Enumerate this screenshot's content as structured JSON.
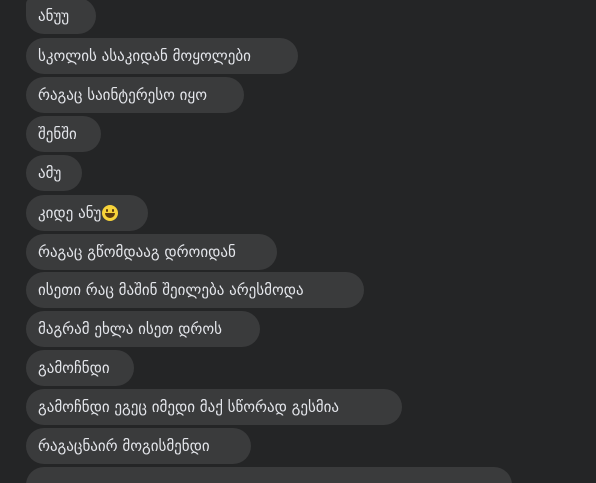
{
  "messages": [
    {
      "text": "ანუუ"
    },
    {
      "text": "სკოლის ასაკიდან მოყოლები"
    },
    {
      "text": "რაგაც საინტერესო იყო"
    },
    {
      "text": "შენში"
    },
    {
      "text": "ამუ"
    },
    {
      "text": "კიდე ანუ",
      "emoji": "grinning-face-icon"
    },
    {
      "text": "რაგაც გწომდააგ დროიდან"
    },
    {
      "text": "ისეთი რაც მაშინ შეილება არესმოდა"
    },
    {
      "text": "მაგრამ ეხლა ისეთ დროს"
    },
    {
      "text": "გამოჩნდი"
    },
    {
      "text": "გამოჩნდი ეგეც იმედი მაქ სწორად გესმია"
    },
    {
      "text": "რაგაცნაირ მოგისმენდი"
    }
  ],
  "colors": {
    "background": "#242526",
    "bubble": "#3a3b3c",
    "text": "#e4e6eb"
  }
}
